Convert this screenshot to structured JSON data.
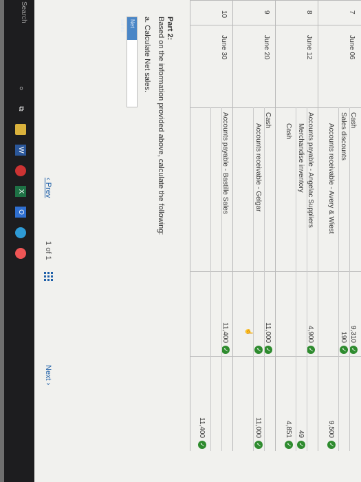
{
  "journal": {
    "rows": [
      {
        "num": "7",
        "date": "June 06",
        "lines": [
          {
            "account": "Cash",
            "debit": "9,310",
            "credit": ""
          },
          {
            "account": "Sales discounts",
            "debit": "190",
            "credit": ""
          },
          {
            "account": "Accounts receivable - Avery & Wiest",
            "debit": "",
            "credit": "9,500"
          }
        ]
      },
      {
        "num": "8",
        "date": "June 12",
        "lines": [
          {
            "account": "Accounts payable - Angelac Suppliers",
            "debit": "4,900",
            "credit": ""
          },
          {
            "account": "Merchandise inventory",
            "debit": "",
            "credit": "49"
          },
          {
            "account": "Cash",
            "debit": "",
            "credit": "4,851"
          }
        ]
      },
      {
        "num": "9",
        "date": "June 20",
        "lines": [
          {
            "account": "Cash",
            "debit": "11,000",
            "credit": ""
          },
          {
            "account": "Accounts receivable - Gelgar",
            "debit": "",
            "credit": "11,000"
          },
          {
            "account": "",
            "debit": "",
            "credit": ""
          }
        ]
      },
      {
        "num": "10",
        "date": "June 30",
        "lines": [
          {
            "account": "Accounts payable - Bastille Sales",
            "debit": "11,400",
            "credit": ""
          },
          {
            "account": "",
            "debit": "",
            "credit": "11,400"
          }
        ]
      }
    ]
  },
  "part2": {
    "title": "Part 2:",
    "instruction": "Based on the information provided above, calculate the following:",
    "question": "a. Calculate Net sales.",
    "net_sales_label": "Net sales",
    "net_sales_value": ""
  },
  "pager": {
    "prev_label": "Prev",
    "page_current": "1",
    "page_of": "of",
    "page_total": "1",
    "next_label": "Next"
  },
  "taskbar": {
    "search_placeholder": "Search"
  },
  "colors": {
    "check": "#2e8b2e",
    "link": "#1e5fa8",
    "net_sales_label_bg": "#4a86c6"
  }
}
